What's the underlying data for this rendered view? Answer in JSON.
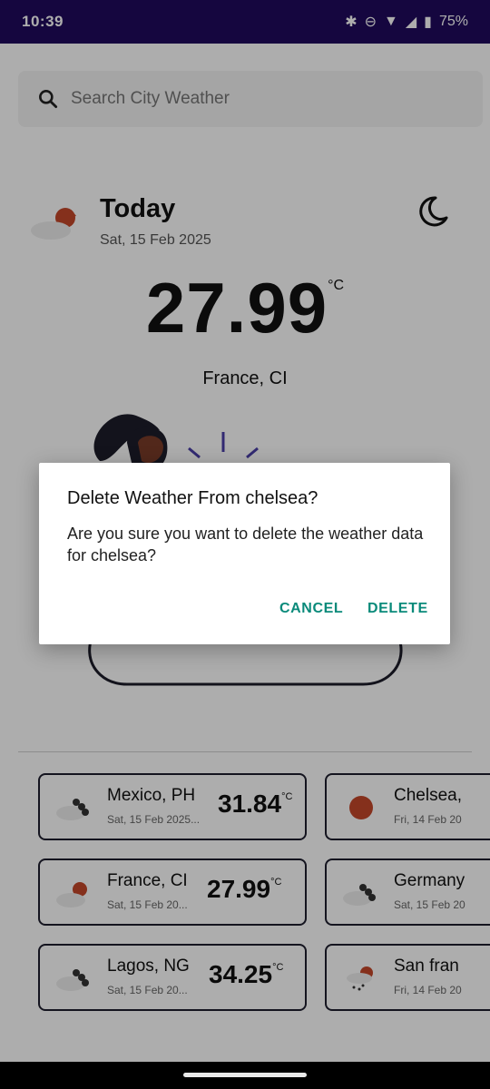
{
  "status_bar": {
    "time": "10:39",
    "battery": "75%",
    "icons": [
      "bluetooth-icon",
      "dnd-icon",
      "wifi-icon",
      "signal-icon",
      "battery-icon"
    ]
  },
  "search": {
    "placeholder": "Search City Weather"
  },
  "today": {
    "title": "Today",
    "date": "Sat, 15 Feb 2025",
    "temperature": "27.99",
    "unit": "°C",
    "location": "France, CI"
  },
  "cards": [
    {
      "city": "Mexico, PH",
      "date": "Sat, 15 Feb 2025...",
      "temp": "31.84",
      "unit": "°C",
      "icon": "dark-cloud-icon"
    },
    {
      "city": "Chelsea,",
      "date": "Fri, 14 Feb 20",
      "temp": "",
      "unit": "",
      "icon": "sun-icon"
    },
    {
      "city": "France, CI",
      "date": "Sat, 15 Feb 20...",
      "temp": "27.99",
      "unit": "°C",
      "icon": "partly-cloudy-icon"
    },
    {
      "city": "Germany",
      "date": "Sat, 15 Feb 20",
      "temp": "",
      "unit": "",
      "icon": "dark-cloud-icon"
    },
    {
      "city": "Lagos, NG",
      "date": "Sat, 15 Feb 20...",
      "temp": "34.25",
      "unit": "°C",
      "icon": "dark-cloud-icon"
    },
    {
      "city": "San fran",
      "date": "Fri, 14 Feb 20",
      "temp": "",
      "unit": "",
      "icon": "rain-icon"
    }
  ],
  "dialog": {
    "title": "Delete Weather From chelsea?",
    "message": "Are you sure you want to delete the weather data for chelsea?",
    "cancel": "CANCEL",
    "delete": "DELETE"
  },
  "colors": {
    "status_bar": "#1f0a5e",
    "accent": "#0a8a7a",
    "sun": "#c4472a"
  }
}
